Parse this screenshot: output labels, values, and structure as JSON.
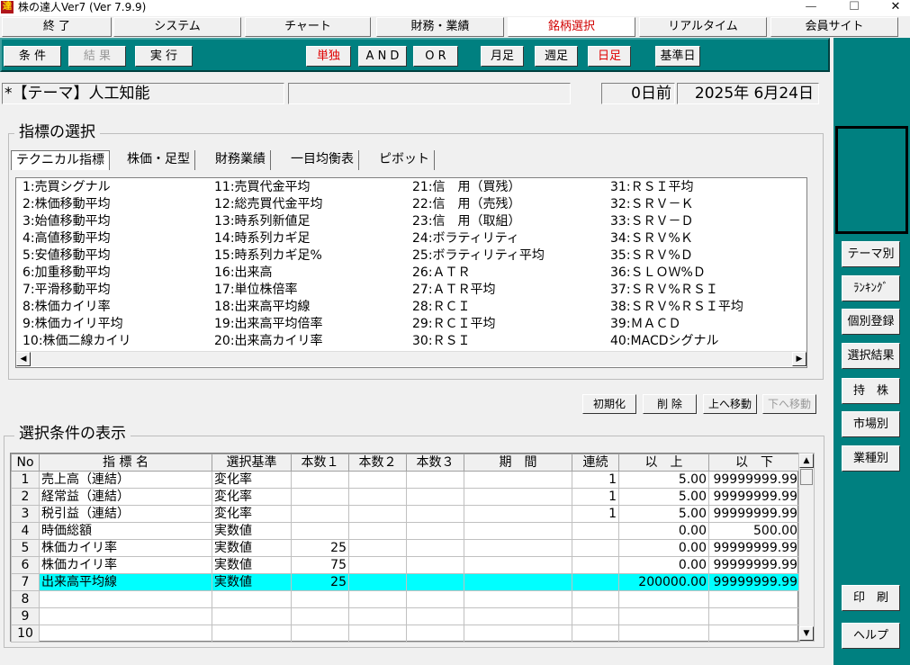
{
  "window": {
    "title": "株の達人Ver7 (Ver 7.9.9)",
    "app_icon": "達",
    "min": "—",
    "max": "☐",
    "close": "✕"
  },
  "menu": [
    "終 了",
    "システム",
    "チャート",
    "財務・業績",
    "銘柄選択",
    "リアルタイム",
    "会員サイト"
  ],
  "toolbar": {
    "cond": "条 件",
    "result": "結 果",
    "exec": "実 行",
    "single": "単独",
    "and": "A N D",
    "or": "O R",
    "monthly": "月足",
    "weekly": "週足",
    "daily": "日足",
    "base_date": "基準日"
  },
  "theme": {
    "label": "*【テーマ】人工知能",
    "days": "0日前",
    "date": "2025年 6月24日"
  },
  "indicator_section": {
    "title": "指標の選択",
    "tabs": [
      "テクニカル指標",
      "株価・足型",
      "財務業績",
      "一目均衡表",
      "ピボット"
    ],
    "items": [
      [
        "1:売買シグナル",
        "2:株価移動平均",
        "3:始値移動平均",
        "4:高値移動平均",
        "5:安値移動平均",
        "6:加重移動平均",
        "7:平滑移動平均",
        "8:株価カイリ率",
        "9:株価カイリ平均",
        "10:株価二線カイリ"
      ],
      [
        "11:売買代金平均",
        "12:総売買代金平均",
        "13:時系列新値足",
        "14:時系列カギ足",
        "15:時系列カギ足%",
        "16:出来高",
        "17:単位株倍率",
        "18:出来高平均線",
        "19:出来高平均倍率",
        "20:出来高カイリ率"
      ],
      [
        "21:信　用（買残）",
        "22:信　用（売残）",
        "23:信　用（取組）",
        "24:ボラティリティ",
        "25:ボラティリティ平均",
        "26:ＡＴＲ",
        "27:ＡＴＲ平均",
        "28:ＲＣＩ",
        "29:ＲＣＩ平均",
        "30:ＲＳＩ"
      ],
      [
        "31:ＲＳＩ平均",
        "32:ＳＲＶ－Ｋ",
        "33:ＳＲＶ－Ｄ",
        "34:ＳＲＶ%Ｋ",
        "35:ＳＲＶ%Ｄ",
        "36:ＳＬＯＷ%Ｄ",
        "37:ＳＲＶ%ＲＳＩ",
        "38:ＳＲＶ%ＲＳＩ平均",
        "39:ＭＡＣＤ",
        "40:MACDシグナル"
      ]
    ]
  },
  "actions": {
    "init": "初期化",
    "delete": "削 除",
    "up": "上へ移動",
    "down": "下へ移動"
  },
  "cond_section": {
    "title": "選択条件の表示",
    "columns": [
      "No",
      "指 標 名",
      "選択基準",
      "本数１",
      "本数２",
      "本数３",
      "期　間",
      "連続",
      "以　上",
      "以　下"
    ],
    "rows": [
      [
        "1",
        "売上高（連結）",
        "変化率",
        "",
        "",
        "",
        "",
        "1",
        "5.00",
        "99999999.99"
      ],
      [
        "2",
        "経常益（連結）",
        "変化率",
        "",
        "",
        "",
        "",
        "1",
        "5.00",
        "99999999.99"
      ],
      [
        "3",
        "税引益（連結）",
        "変化率",
        "",
        "",
        "",
        "",
        "1",
        "5.00",
        "99999999.99"
      ],
      [
        "4",
        "時価総額",
        "実数値",
        "",
        "",
        "",
        "",
        "",
        "0.00",
        "500.00"
      ],
      [
        "5",
        "株価カイリ率",
        "実数値",
        "25",
        "",
        "",
        "",
        "",
        "0.00",
        "99999999.99"
      ],
      [
        "6",
        "株価カイリ率",
        "実数値",
        "75",
        "",
        "",
        "",
        "",
        "0.00",
        "99999999.99"
      ],
      [
        "7",
        "出来高平均線",
        "実数値",
        "25",
        "",
        "",
        "",
        "",
        "200000.00",
        "99999999.99"
      ],
      [
        "8",
        "",
        "",
        "",
        "",
        "",
        "",
        "",
        "",
        ""
      ],
      [
        "9",
        "",
        "",
        "",
        "",
        "",
        "",
        "",
        "",
        ""
      ],
      [
        "10",
        "",
        "",
        "",
        "",
        "",
        "",
        "",
        "",
        ""
      ]
    ],
    "highlight_row": 7
  },
  "side": [
    "テーマ別",
    "ﾗﾝｷﾝｸﾞ",
    "個別登録",
    "選択結果",
    "持　株",
    "市場別",
    "業種別",
    "印　刷",
    "ヘルプ"
  ]
}
